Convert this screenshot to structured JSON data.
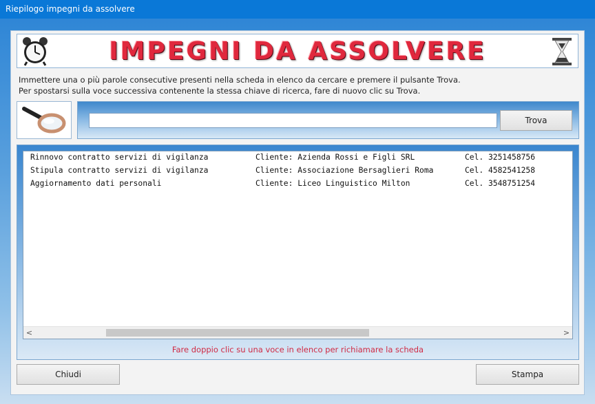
{
  "window": {
    "title": "Riepilogo impegni da assolvere"
  },
  "banner": {
    "title": "IMPEGNI DA ASSOLVERE",
    "left_icon": "alarm-clock-icon",
    "right_icon": "hourglass-icon"
  },
  "instructions": {
    "line1": "Immettere una o più parole consecutive presenti nella scheda in elenco da cercare e premere il pulsante Trova.",
    "line2": "Per spostarsi sulla voce successiva contenente la stessa chiave di ricerca, fare di nuovo clic su Trova."
  },
  "search": {
    "value": "",
    "icon": "magnifier-icon",
    "button_label": "Trova"
  },
  "list": {
    "rows": [
      {
        "title": "Rinnovo contratto servizi di vigilanza",
        "client": "Cliente: Azienda Rossi e Figli SRL",
        "phone": "Cel. 3251458756"
      },
      {
        "title": "Stipula contratto servizi di vigilanza",
        "client": "Cliente: Associazione Bersaglieri Roma",
        "phone": "Cel. 4582541258"
      },
      {
        "title": "Aggiornamento dati personali",
        "client": "Cliente: Liceo Linguistico Milton",
        "phone": "Cel. 3548751254"
      }
    ],
    "scroll_left": "<",
    "scroll_right": ">",
    "hint": "Fare doppio clic su una voce in elenco per richiamare la scheda"
  },
  "footer": {
    "close_label": "Chiudi",
    "print_label": "Stampa"
  },
  "colors": {
    "titlebar": "#0a78d7",
    "banner_text": "#e0283d",
    "hint_text": "#d02a44"
  }
}
